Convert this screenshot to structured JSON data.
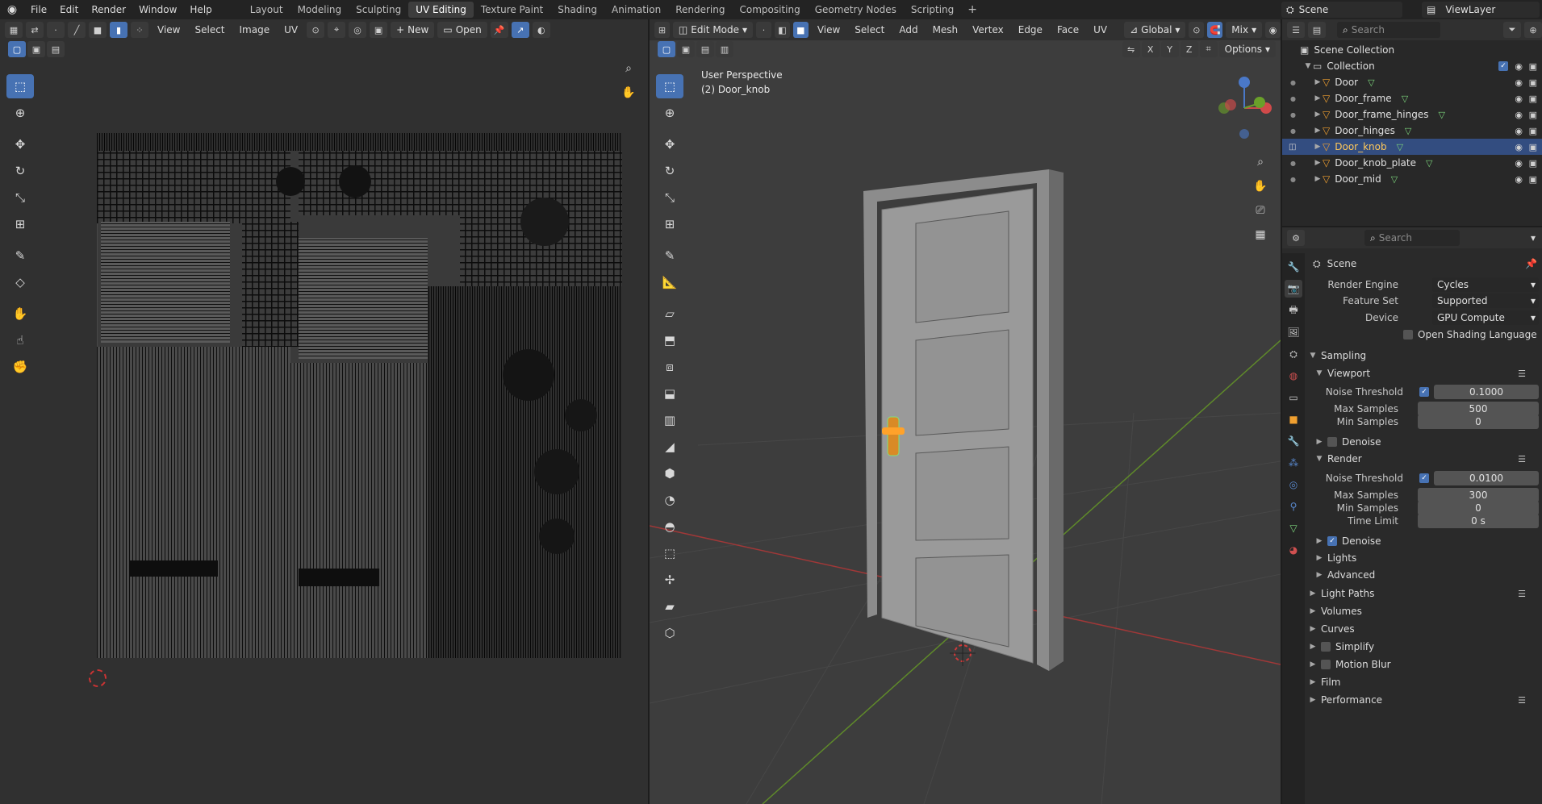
{
  "topbar": {
    "menus": [
      "File",
      "Edit",
      "Render",
      "Window",
      "Help"
    ],
    "workspaces": [
      "Layout",
      "Modeling",
      "Sculpting",
      "UV Editing",
      "Texture Paint",
      "Shading",
      "Animation",
      "Rendering",
      "Compositing",
      "Geometry Nodes",
      "Scripting"
    ],
    "active_workspace": "UV Editing",
    "scene_name": "Scene",
    "view_layer": "ViewLayer"
  },
  "uv_editor": {
    "menus": [
      "View",
      "Select",
      "Image",
      "UV"
    ],
    "new_label": "New",
    "open_label": "Open"
  },
  "viewport": {
    "mode": "Edit Mode",
    "menus": [
      "View",
      "Select",
      "Add",
      "Mesh",
      "Vertex",
      "Edge",
      "Face",
      "UV"
    ],
    "transform_orientation": "Global",
    "shading_mix": "Mix",
    "axes": [
      "X",
      "Y",
      "Z"
    ],
    "options_label": "Options",
    "overlay_title": "User Perspective",
    "overlay_object": "(2) Door_knob"
  },
  "outliner": {
    "search_placeholder": "Search",
    "scene_collection": "Scene Collection",
    "collection": "Collection",
    "objects": [
      "Door",
      "Door_frame",
      "Door_frame_hinges",
      "Door_hinges",
      "Door_knob",
      "Door_knob_plate",
      "Door_mid"
    ],
    "selected": "Door_knob"
  },
  "properties": {
    "search_placeholder": "Search",
    "context": "Scene",
    "render_engine_label": "Render Engine",
    "render_engine": "Cycles",
    "feature_set_label": "Feature Set",
    "feature_set": "Supported",
    "device_label": "Device",
    "device": "GPU Compute",
    "osl_label": "Open Shading Language",
    "sampling": "Sampling",
    "viewport": "Viewport",
    "noise_threshold_label": "Noise Threshold",
    "vp_noise_threshold": "0.1000",
    "max_samples_label": "Max Samples",
    "vp_max_samples": "500",
    "min_samples_label": "Min Samples",
    "vp_min_samples": "0",
    "denoise_label": "Denoise",
    "render": "Render",
    "r_noise_threshold": "0.0100",
    "r_max_samples": "300",
    "r_min_samples": "0",
    "time_limit_label": "Time Limit",
    "r_time_limit": "0 s",
    "lights": "Lights",
    "advanced": "Advanced",
    "panels": [
      "Light Paths",
      "Volumes",
      "Curves",
      "Simplify",
      "Motion Blur",
      "Film",
      "Performance"
    ]
  },
  "colors": {
    "accent": "#4772b3",
    "selection": "#334d80",
    "object_orange": "#f0a030",
    "mesh_green": "#7bd37b",
    "x_axis": "#c03c3c",
    "y_axis": "#6a9a2a"
  }
}
